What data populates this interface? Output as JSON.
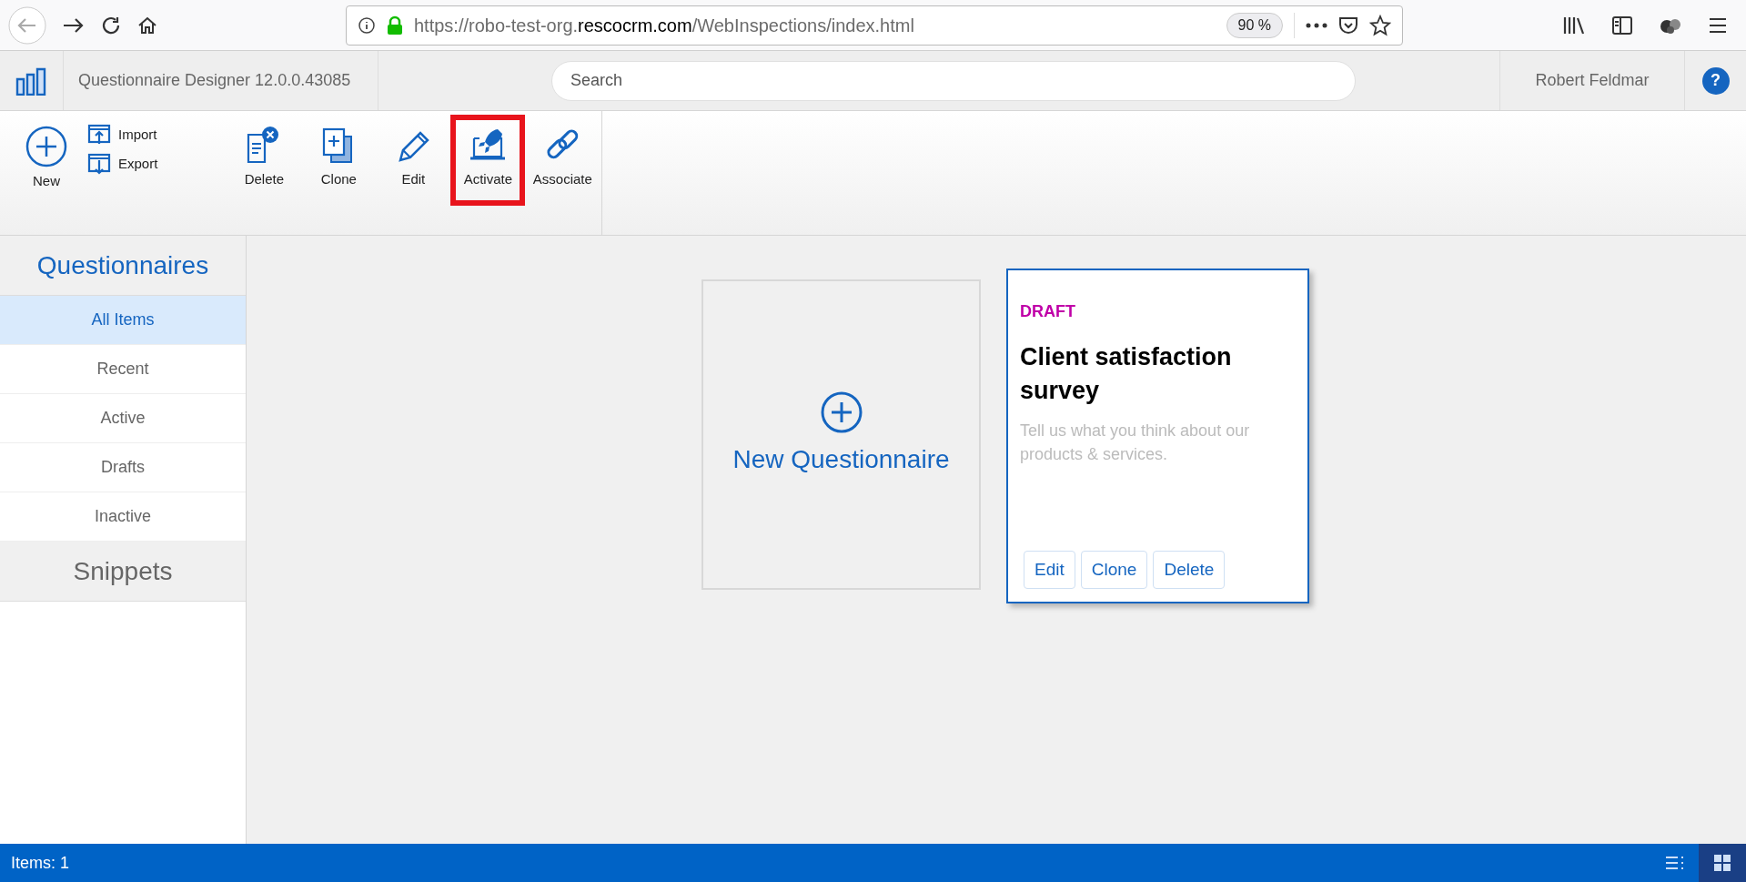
{
  "browser": {
    "url": "https://robo-test-org.**rescocrm.com**/WebInspections/index.html",
    "zoom": "90 %"
  },
  "header": {
    "title": "Questionnaire Designer 12.0.0.43085",
    "search": {
      "placeholder": "Search"
    },
    "user": "Robert Feldmar",
    "help": "?"
  },
  "toolbar": [
    {
      "kind": "big",
      "label": "New",
      "highlighted": false
    },
    {
      "kind": "stack",
      "items": [
        {
          "label": "Import"
        },
        {
          "label": "Export"
        }
      ]
    },
    {
      "kind": "big",
      "label": "Delete",
      "highlighted": false
    },
    {
      "kind": "big",
      "label": "Clone",
      "highlighted": false
    },
    {
      "kind": "big",
      "label": "Edit",
      "highlighted": false
    },
    {
      "kind": "big",
      "label": "Activate",
      "highlighted": true
    },
    {
      "kind": "big",
      "label": "Associate",
      "highlighted": false
    }
  ],
  "sidebar": {
    "sections": [
      {
        "title": "Questionnaires",
        "items": [
          {
            "label": "All Items",
            "selected": true
          },
          {
            "label": "Recent",
            "selected": false
          },
          {
            "label": "Active",
            "selected": false
          },
          {
            "label": "Drafts",
            "selected": false
          },
          {
            "label": "Inactive",
            "selected": false
          }
        ]
      },
      {
        "title": "Snippets"
      }
    ]
  },
  "new_card": {
    "label": "New Questionnaire"
  },
  "cards": [
    {
      "status": "DRAFT",
      "color": "#c000a8",
      "title": "Client satisfaction survey",
      "description": "Tell us what you think about our products & services.",
      "buttons": [
        "Edit",
        "Clone",
        "Delete"
      ]
    }
  ],
  "status_bar": {
    "text": "Items: 1",
    "views": [
      {
        "selected": false
      },
      {
        "selected": true
      }
    ]
  }
}
